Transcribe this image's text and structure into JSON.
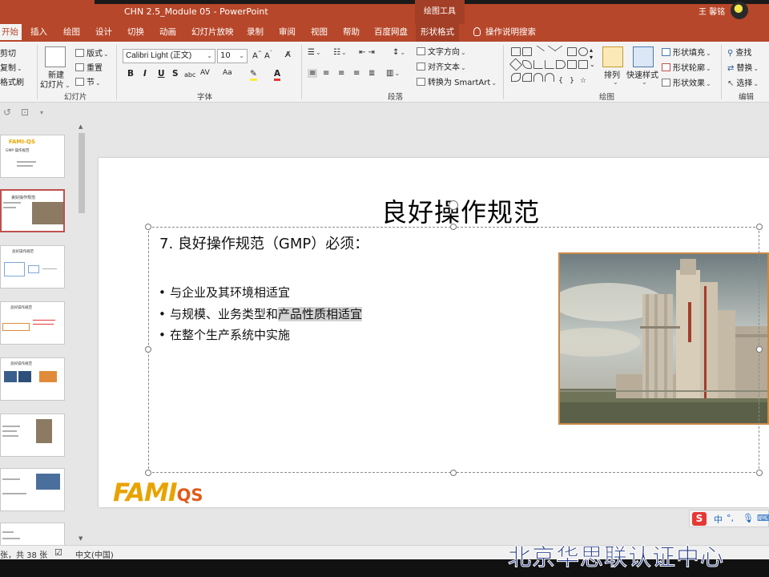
{
  "titlebar": {
    "document_title": "CHN 2.5_Module 05  -  PowerPoint",
    "context_label": "绘图工具",
    "user": "王 馨铭"
  },
  "tabs": [
    {
      "label": "开始",
      "active": true
    },
    {
      "label": "插入"
    },
    {
      "label": "绘图"
    },
    {
      "label": "设计"
    },
    {
      "label": "切换"
    },
    {
      "label": "动画"
    },
    {
      "label": "幻灯片放映"
    },
    {
      "label": "录制"
    },
    {
      "label": "审阅"
    },
    {
      "label": "视图"
    },
    {
      "label": "帮助"
    },
    {
      "label": "百度网盘"
    },
    {
      "label": "形状格式"
    },
    {
      "label": "操作说明搜索"
    }
  ],
  "ribbon": {
    "clipboard": {
      "cut": "剪切",
      "copy": "复制",
      "format_painter": "格式刷"
    },
    "slides": {
      "new_slide": "新建",
      "new_slide2": "幻灯片",
      "layout": "版式",
      "reset": "重置",
      "section": "节"
    },
    "font": {
      "font_name": "Calibri Light (正文)",
      "font_size": "10"
    },
    "paragraph": {
      "text_direction": "文字方向",
      "align_text": "对齐文本",
      "smartart": "转换为 SmartArt"
    },
    "drawing": {
      "arrange": "排列",
      "quick_styles": "快速样式",
      "shape_fill": "形状填充",
      "shape_outline": "形状轮廓",
      "shape_effects": "形状效果"
    },
    "editing": {
      "find": "查找",
      "replace": "替换",
      "select": "选择"
    },
    "groups": {
      "slides": "幻灯片",
      "font": "字体",
      "paragraph": "段落",
      "drawing": "绘图",
      "editing": "编辑"
    }
  },
  "slide": {
    "title": "良好操作规范",
    "heading": "7. 良好操作规范（GMP）必须：",
    "bullets": [
      {
        "plain": "与企业及其环境相适宜",
        "selected": ""
      },
      {
        "plain": "与规模、业务类型和",
        "selected": "产品性质相适宜"
      },
      {
        "plain": "在整个生产系统中实施",
        "selected": ""
      }
    ],
    "logo_main": "FAMI",
    "logo_sub": "QS"
  },
  "thumbnails": [
    {
      "title": "FAMI-QS",
      "subtitle": "GMP 操作规范"
    },
    {
      "title": "良好操作规范"
    },
    {
      "title": "良好操作规范"
    },
    {
      "title": "良好操作规范"
    },
    {
      "title": "良好操作规范"
    },
    {
      "title": ""
    },
    {
      "title": ""
    },
    {
      "title": ""
    }
  ],
  "ime": {
    "logo": "S",
    "mode": "中"
  },
  "statusbar": {
    "slide_count": "张，共 38 张",
    "language": "中文(中国)"
  },
  "watermark": "北京华思联认证中心",
  "colors": {
    "accent": "#b7472a",
    "logo_yellow": "#e8a300",
    "logo_orange": "#e15b1b"
  }
}
